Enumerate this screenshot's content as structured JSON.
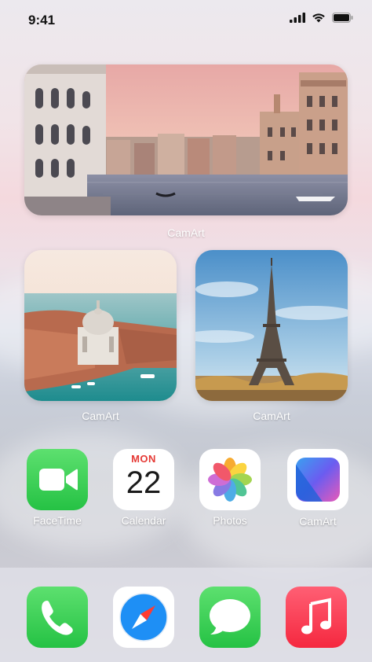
{
  "status_bar": {
    "time": "9:41"
  },
  "widgets": {
    "venice_canal": {
      "label": "CamArt"
    },
    "venice_aerial": {
      "label": "CamArt"
    },
    "eiffel": {
      "label": "CamArt"
    }
  },
  "apps": [
    {
      "label": "FaceTime",
      "icon": "facetime-icon"
    },
    {
      "label": "Calendar",
      "icon": "calendar-icon",
      "month": "MON",
      "day": "22"
    },
    {
      "label": "Photos",
      "icon": "photos-icon"
    },
    {
      "label": "CamArt",
      "icon": "camart-icon"
    }
  ],
  "dock": [
    {
      "icon": "phone-icon"
    },
    {
      "icon": "safari-icon"
    },
    {
      "icon": "messages-icon"
    },
    {
      "icon": "music-icon"
    }
  ],
  "colors": {
    "facetime": "#34c759",
    "calendar_red": "#e53935",
    "music": "#fb3a55",
    "safari_blue": "#1e8ff5"
  }
}
